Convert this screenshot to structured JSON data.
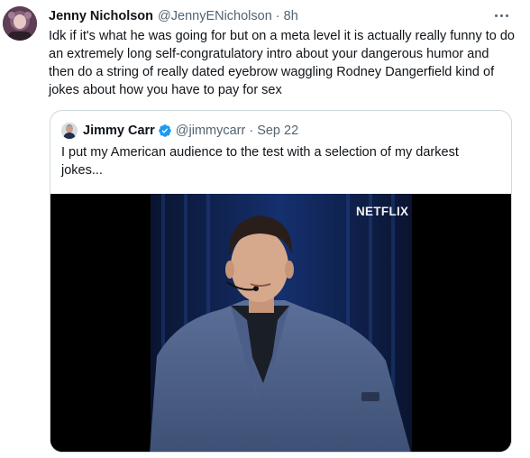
{
  "tweet": {
    "author_name": "Jenny Nicholson",
    "author_handle": "@JennyENicholson",
    "separator": "·",
    "time": "8h",
    "text": "Idk if it's what he was going for but on a meta level it is actually really funny to do an extremely long self-congratulatory intro about your dangerous humor and then do a string of really dated eyebrow waggling Rodney Dangerfield kind of jokes about how you have to pay for sex",
    "avatar_icon": "avatar-image",
    "more_icon": "more-horizontal-icon"
  },
  "quote": {
    "author_name": "Jimmy Carr",
    "author_handle": "@jimmycarr",
    "separator": "·",
    "time": "Sep 22",
    "verified_icon": "verified-badge-icon",
    "verified_color": "#1d9bf0",
    "text": "I put my American audience to the test with a selection of my darkest jokes...",
    "media": {
      "watermark": "NETFLIX",
      "description_icon": "video-thumbnail"
    }
  },
  "colors": {
    "text_primary": "#0f1419",
    "text_secondary": "#536471",
    "border": "#cfd9de"
  }
}
